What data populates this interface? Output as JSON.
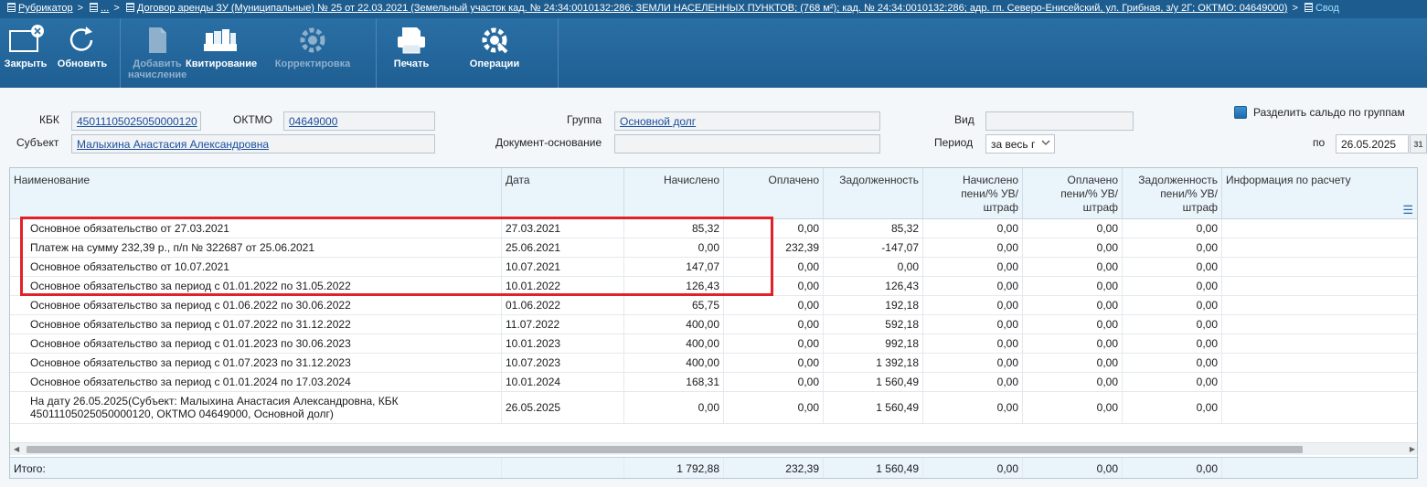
{
  "breadcrumb": {
    "items": [
      "Рубрикатор",
      "...",
      "Договор аренды ЗУ (Муниципальные) № 25 от 22.03.2021 (Земельный участок кад. № 24:34:0010132:286; ЗЕМЛИ НАСЕЛЕННЫХ ПУНКТОВ; (768 м²); кад. № 24:34:0010132:286; адр. гп. Северо-Енисейский, ул. Грибная, з/у 2Г; ОКТМО: 04649000)",
      "Свод"
    ],
    "separator": ">"
  },
  "toolbar": {
    "close": "Закрыть",
    "refresh": "Обновить",
    "add_charge_line1": "Добавить",
    "add_charge_line2": "начисление",
    "receipting": "Квитирование",
    "correction": "Корректировка",
    "print": "Печать",
    "operations": "Операции"
  },
  "form": {
    "kbk_label": "КБК",
    "kbk_value": "45011105025050000120",
    "oktmo_label": "ОКТМО",
    "oktmo_value": "04649000",
    "subject_label": "Субъект",
    "subject_value": "Малыхина Анастасия Александровна",
    "group_label": "Группа",
    "group_value": "Основной долг",
    "basis_doc_label": "Документ-основание",
    "basis_doc_value": "",
    "kind_label": "Вид",
    "kind_value": "",
    "period_label": "Период",
    "period_value": "за весь г",
    "split_label": "Разделить сальдо по группам",
    "to_label": "по",
    "to_date": "26.05.2025",
    "calendar_icon_text": "31"
  },
  "grid": {
    "headers": {
      "name": "Наименование",
      "date": "Дата",
      "accrued": "Начислено",
      "paid": "Оплачено",
      "debt": "Задолженность",
      "accrued_pen_l1": "Начислено",
      "accrued_pen_l2": "пени/% УВ/",
      "accrued_pen_l3": "штраф",
      "paid_pen_l1": "Оплачено",
      "paid_pen_l2": "пени/% УВ/",
      "paid_pen_l3": "штраф",
      "debt_pen_l1": "Задолженность",
      "debt_pen_l2": "пени/% УВ/",
      "debt_pen_l3": "штраф",
      "info": "Информация по расчету"
    },
    "rows": [
      {
        "name": "Основное обязательство от 27.03.2021",
        "date": "27.03.2021",
        "accrued": "85,32",
        "paid": "0,00",
        "debt": "85,32",
        "accrued_pen": "0,00",
        "paid_pen": "0,00",
        "debt_pen": "0,00",
        "info": ""
      },
      {
        "name": "Платеж на сумму 232,39 р., п/п № 322687 от 25.06.2021",
        "date": "25.06.2021",
        "accrued": "0,00",
        "paid": "232,39",
        "debt": "-147,07",
        "accrued_pen": "0,00",
        "paid_pen": "0,00",
        "debt_pen": "0,00",
        "info": ""
      },
      {
        "name": "Основное обязательство от 10.07.2021",
        "date": "10.07.2021",
        "accrued": "147,07",
        "paid": "0,00",
        "debt": "0,00",
        "accrued_pen": "0,00",
        "paid_pen": "0,00",
        "debt_pen": "0,00",
        "info": ""
      },
      {
        "name": "Основное обязательство за период с 01.01.2022 по 31.05.2022",
        "date": "10.01.2022",
        "accrued": "126,43",
        "paid": "0,00",
        "debt": "126,43",
        "accrued_pen": "0,00",
        "paid_pen": "0,00",
        "debt_pen": "0,00",
        "info": ""
      },
      {
        "name": "Основное обязательство за период с 01.06.2022 по 30.06.2022",
        "date": "01.06.2022",
        "accrued": "65,75",
        "paid": "0,00",
        "debt": "192,18",
        "accrued_pen": "0,00",
        "paid_pen": "0,00",
        "debt_pen": "0,00",
        "info": ""
      },
      {
        "name": "Основное обязательство за период с 01.07.2022 по 31.12.2022",
        "date": "11.07.2022",
        "accrued": "400,00",
        "paid": "0,00",
        "debt": "592,18",
        "accrued_pen": "0,00",
        "paid_pen": "0,00",
        "debt_pen": "0,00",
        "info": ""
      },
      {
        "name": "Основное обязательство за период с 01.01.2023 по 30.06.2023",
        "date": "10.01.2023",
        "accrued": "400,00",
        "paid": "0,00",
        "debt": "992,18",
        "accrued_pen": "0,00",
        "paid_pen": "0,00",
        "debt_pen": "0,00",
        "info": ""
      },
      {
        "name": "Основное обязательство за период с 01.07.2023 по 31.12.2023",
        "date": "10.07.2023",
        "accrued": "400,00",
        "paid": "0,00",
        "debt": "1 392,18",
        "accrued_pen": "0,00",
        "paid_pen": "0,00",
        "debt_pen": "0,00",
        "info": ""
      },
      {
        "name": "Основное обязательство за период с 01.01.2024 по 17.03.2024",
        "date": "10.01.2024",
        "accrued": "168,31",
        "paid": "0,00",
        "debt": "1 560,49",
        "accrued_pen": "0,00",
        "paid_pen": "0,00",
        "debt_pen": "0,00",
        "info": ""
      },
      {
        "name": "На дату 26.05.2025(Субъект: Малыхина Анастасия Александровна, КБК 45011105025050000120, ОКТМО 04649000, Основной долг)",
        "date": "26.05.2025",
        "accrued": "0,00",
        "paid": "0,00",
        "debt": "1 560,49",
        "accrued_pen": "0,00",
        "paid_pen": "0,00",
        "debt_pen": "0,00",
        "info": ""
      }
    ],
    "totals": {
      "label": "Итого:",
      "accrued": "1 792,88",
      "paid": "232,39",
      "debt": "1 560,49",
      "accrued_pen": "0,00",
      "paid_pen": "0,00",
      "debt_pen": "0,00"
    }
  },
  "colors": {
    "header_bg": "#2c73a9",
    "highlight": "#e2202a",
    "link": "#1c4fa0"
  }
}
